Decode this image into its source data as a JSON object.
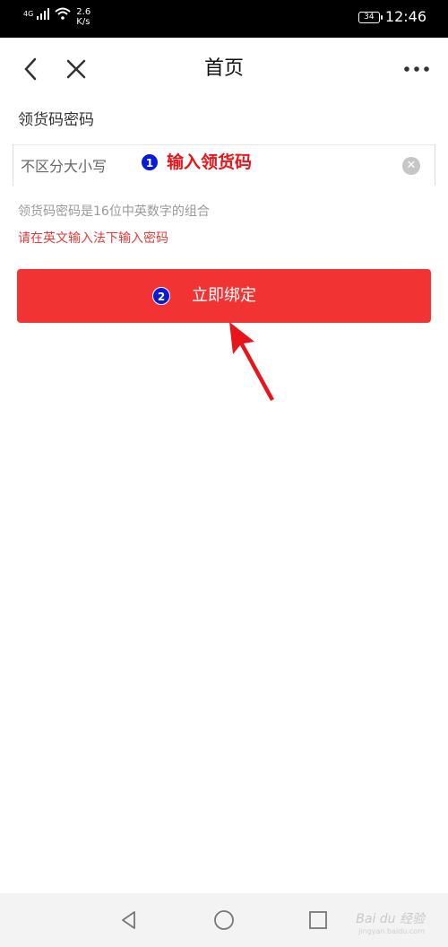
{
  "status_bar": {
    "network": "4G",
    "speed_value": "2.6",
    "speed_unit": "K/s",
    "battery": "34",
    "time": "12:46"
  },
  "nav": {
    "title": "首页",
    "back_icon": "chevron-left-icon",
    "close_icon": "close-icon",
    "more_icon": "more-dots-icon"
  },
  "form": {
    "label": "领货码密码",
    "input_value": "",
    "input_placeholder": "不区分大小写",
    "hint_gray": "领货码密码是16位中英数字的组合",
    "hint_red": "请在英文输入法下输入密码",
    "submit_label": "立即绑定"
  },
  "annotations": {
    "step1_number": "1",
    "step1_text": "输入领货码",
    "step2_number": "2"
  },
  "colors": {
    "accent": "#f23334",
    "hint_red": "#e53b3b",
    "annotation_red": "#e8151b",
    "badge_blue": "#0a1bd6"
  },
  "watermark": {
    "brand": "Bai du 经验",
    "url": "jingyan.baidu.com"
  }
}
